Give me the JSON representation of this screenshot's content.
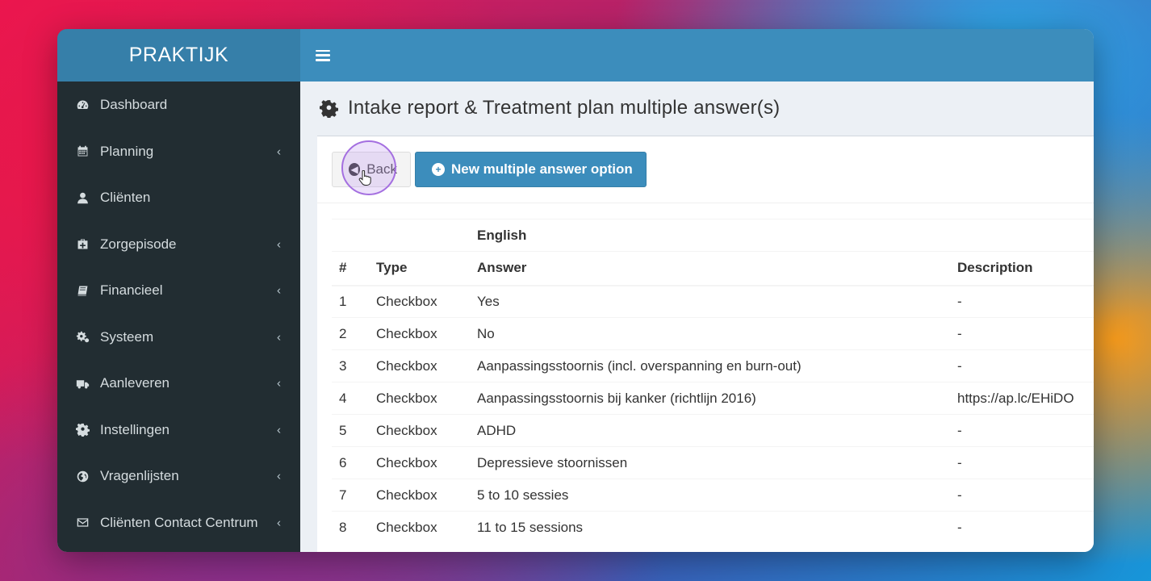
{
  "app": {
    "logo": "PRAKTIJK"
  },
  "sidebar": {
    "items": [
      {
        "label": "Dashboard",
        "icon": "dashboard-icon",
        "has_submenu": false
      },
      {
        "label": "Planning",
        "icon": "calendar-icon",
        "has_submenu": true
      },
      {
        "label": "Cliënten",
        "icon": "user-icon",
        "has_submenu": false
      },
      {
        "label": "Zorgepisode",
        "icon": "medkit-icon",
        "has_submenu": true
      },
      {
        "label": "Financieel",
        "icon": "book-icon",
        "has_submenu": true
      },
      {
        "label": "Systeem",
        "icon": "cogs-icon",
        "has_submenu": true
      },
      {
        "label": "Aanleveren",
        "icon": "truck-icon",
        "has_submenu": true
      },
      {
        "label": "Instellingen",
        "icon": "gear-icon",
        "has_submenu": true
      },
      {
        "label": "Vragenlijsten",
        "icon": "globe-icon",
        "has_submenu": true
      },
      {
        "label": "Cliënten Contact Centrum",
        "icon": "envelope-icon",
        "has_submenu": true
      }
    ],
    "chevron": "‹"
  },
  "page": {
    "title": "Intake report & Treatment plan multiple answer(s)",
    "title_icon": "gear-icon"
  },
  "toolbar": {
    "back_label": "Back",
    "new_label": "New multiple answer option"
  },
  "table": {
    "group_header": "English",
    "columns": [
      "#",
      "Type",
      "Answer",
      "Description"
    ],
    "rows": [
      {
        "num": "1",
        "type": "Checkbox",
        "answer": "Yes",
        "description": "-"
      },
      {
        "num": "2",
        "type": "Checkbox",
        "answer": "No",
        "description": "-"
      },
      {
        "num": "3",
        "type": "Checkbox",
        "answer": "Aanpassingsstoornis (incl. overspanning en burn-out)",
        "description": "-"
      },
      {
        "num": "4",
        "type": "Checkbox",
        "answer": "Aanpassingsstoornis bij kanker (richtlijn 2016)",
        "description": "https://ap.lc/EHiDO"
      },
      {
        "num": "5",
        "type": "Checkbox",
        "answer": "ADHD",
        "description": "-"
      },
      {
        "num": "6",
        "type": "Checkbox",
        "answer": "Depressieve stoornissen",
        "description": "-"
      },
      {
        "num": "7",
        "type": "Checkbox",
        "answer": "5 to 10 sessies",
        "description": "-"
      },
      {
        "num": "8",
        "type": "Checkbox",
        "answer": "11 to 15 sessions",
        "description": "-"
      }
    ]
  },
  "colors": {
    "sidebar_bg": "#222d32",
    "header_bg": "#3c8dbc",
    "logo_bg": "#367fa9",
    "primary": "#3c8dbc",
    "click_highlight": "#a46fe0"
  }
}
